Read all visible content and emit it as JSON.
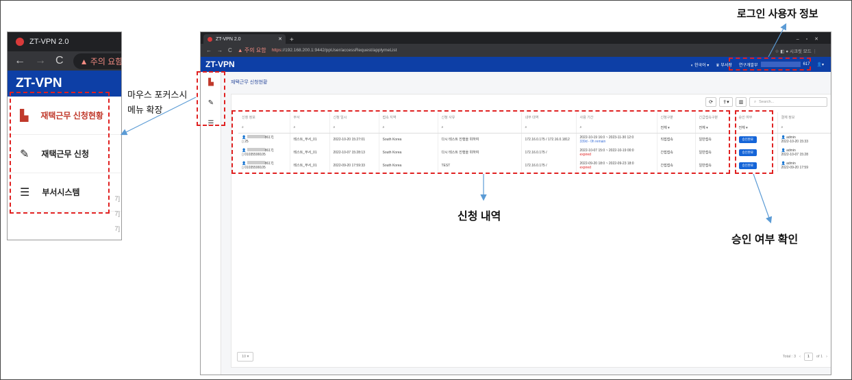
{
  "zoom": {
    "tab_title": "ZT-VPN 2.0",
    "warning_text": "주의 요함",
    "brand": "ZT-VPN",
    "menu": [
      {
        "label": "재택근무 신청현황",
        "icon": "document-icon"
      },
      {
        "label": "재택근무 신청",
        "icon": "edit-icon"
      },
      {
        "label": "부서시스템",
        "icon": "server-icon"
      }
    ]
  },
  "browser": {
    "tab_title": "ZT-VPN 2.0",
    "warning": "주의 요함",
    "url_scheme": "https",
    "url_rest": "://192.168.200.1:9442/ppUser/accessRequest/applymeList",
    "profile_label": "시크릿 모드"
  },
  "app": {
    "brand": "ZT-VPN",
    "language": "한국어",
    "role": "부서장",
    "dept": "연구개발부",
    "user_suffix": "617",
    "page_title": "재택근무 신청현황"
  },
  "toolbar": {
    "search_placeholder": "Search..."
  },
  "table": {
    "columns": [
      "신청 정보",
      "부서",
      "신청 일시",
      "접속 지역",
      "신청 사유",
      "내부 대역",
      "사용 기간",
      "신청구분",
      "긴급접속구분",
      "승인 여부",
      "결재 정보"
    ],
    "filter_all": "전체",
    "rows": [
      {
        "phone_suffix": "8617]",
        "phone": "25",
        "dept": "테스트_부서_01",
        "date": "2022-10-20 15:27:01",
        "region": "South Korea",
        "reason": "다시 테스트 진행을 위하여",
        "ip": "172.16.0.175 / 172.16.0.1812",
        "period": "2022-10-19 16:0 ~ 2023-11-30 12:0",
        "period_note": "339d - 0h remain",
        "note_type": "remain",
        "type": "직접접속",
        "urgent": "일반접속",
        "approve": "승인완료",
        "approver": "admin",
        "approve_date": "2022-10-20 15:33"
      },
      {
        "phone_suffix": "8617]",
        "phone": "01035599105",
        "dept": "테스트_부서_01",
        "date": "2022-10-07 15:28:13",
        "region": "South Korea",
        "reason": "다시 테스트 진행을 위하여",
        "ip": "172.16.0.175 /",
        "period": "2022-10-07 15:0 ~ 2022-10-19 00:0",
        "period_note": "expired",
        "note_type": "expired",
        "type": "간접접속",
        "urgent": "일반접속",
        "approve": "승인완료",
        "approver": "admin",
        "approve_date": "2022-10-07 15:28"
      },
      {
        "phone_suffix": "8617]",
        "phone": "01035599105",
        "dept": "테스트_부서_01",
        "date": "2022-09-20 17:59:33",
        "region": "South Korea",
        "reason": "TEST",
        "ip": "172.16.0.175 /",
        "period": "2022-09-20 18:0 ~ 2022-09-23 18:0",
        "period_note": "expired",
        "note_type": "expired",
        "type": "간접접속",
        "urgent": "일반접속",
        "approve": "승인완료",
        "approver": "admin",
        "approve_date": "2022-09-20 17:59"
      }
    ]
  },
  "footer": {
    "page_size": "10",
    "total": "Total : 3",
    "page": "1",
    "of": "of 1"
  },
  "annotations": {
    "login_info": "로그인 사용자 정보",
    "hover_line1": "마우스 포커스시",
    "hover_line2": "메뉴 확장",
    "history": "신청 내역",
    "approval": "승인 여부 확인"
  },
  "colors": {
    "brand_blue": "#0d3fa6",
    "highlight_red": "#e02020",
    "approve_blue": "#1565d8"
  }
}
